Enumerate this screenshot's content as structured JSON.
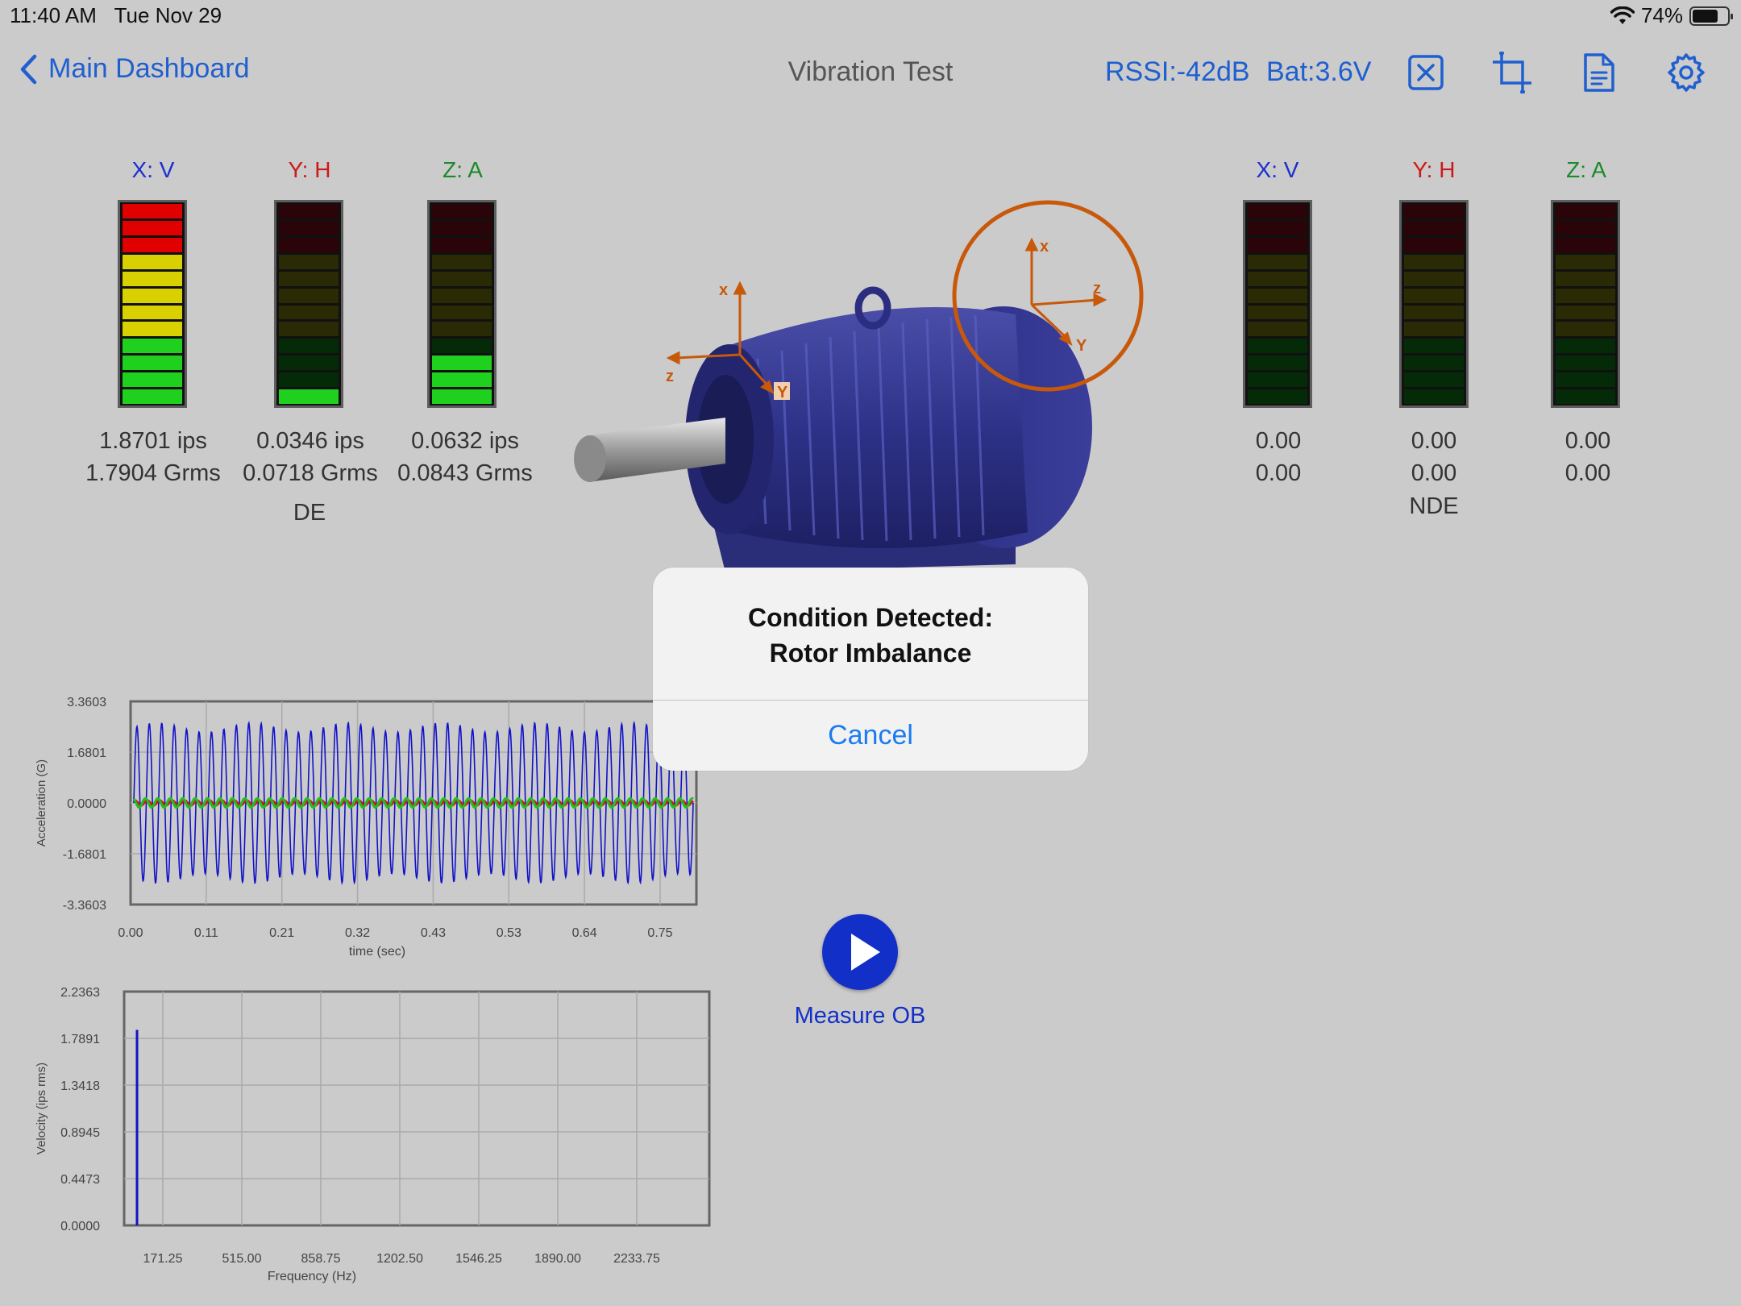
{
  "status": {
    "time": "11:40 AM",
    "date": "Tue Nov 29",
    "battery": "74%",
    "battery_level": 0.74,
    "wifi_icon": "wifi-icon"
  },
  "nav": {
    "back_label": "Main Dashboard",
    "title": "Vibration Test",
    "rssi": "RSSI:-42dB",
    "bat": "Bat:3.6V",
    "icons": [
      "close-box-icon",
      "crop-icon",
      "document-icon",
      "gear-icon"
    ],
    "accent_color": "#1f5fcf"
  },
  "sensors": {
    "de": {
      "label": "DE",
      "channels": [
        {
          "axis": "X: V",
          "color": "#1a2fd0",
          "lit_segments": 12,
          "ips": "1.8701 ips",
          "grms": "1.7904 Grms"
        },
        {
          "axis": "Y: H",
          "color": "#cc1a1a",
          "lit_segments": 1,
          "ips": "0.0346 ips",
          "grms": "0.0718 Grms"
        },
        {
          "axis": "Z: A",
          "color": "#1a8a2a",
          "lit_segments": 3,
          "ips": "0.0632 ips",
          "grms": "0.0843 Grms"
        }
      ]
    },
    "nde": {
      "label": "NDE",
      "channels": [
        {
          "axis": "X: V",
          "color": "#1a2fd0",
          "lit_segments": 0,
          "ips": "0.00",
          "grms": "0.00"
        },
        {
          "axis": "Y: H",
          "color": "#cc1a1a",
          "lit_segments": 0,
          "ips": "0.00",
          "grms": "0.00"
        },
        {
          "axis": "Z: A",
          "color": "#1a8a2a",
          "lit_segments": 0,
          "ips": "0.00",
          "grms": "0.00"
        }
      ]
    },
    "segment_count": 12,
    "segment_colors": {
      "red": "#e00000",
      "yellow": "#d8d000",
      "green": "#1fd01f",
      "red_off": "#2a0408",
      "yellow_off": "#2a2a04",
      "green_off": "#052a08"
    }
  },
  "motor_axes": {
    "de": [
      "x",
      "z",
      "Y"
    ],
    "nde": [
      "x",
      "z",
      "Y"
    ]
  },
  "chart_data": [
    {
      "type": "line",
      "xlabel": "time (sec)",
      "ylabel": "Acceleration (G)",
      "xlim": [
        0,
        0.75
      ],
      "ylim": [
        -3.3603,
        3.3603
      ],
      "x_ticks": [
        "0.00",
        "0.11",
        "0.21",
        "0.32",
        "0.43",
        "0.53",
        "0.64",
        "0.75"
      ],
      "y_ticks": [
        "3.3603",
        "1.6801",
        "0.0000",
        "-1.6801",
        "-3.3603"
      ],
      "grid": true,
      "series": [
        {
          "color": "#1212c8",
          "amplitude": 2.6,
          "cycles": 45
        },
        {
          "color": "#cc1a1a",
          "amplitude": 0.08,
          "cycles": 45
        },
        {
          "color": "#1fc01f",
          "amplitude": 0.15,
          "cycles": 45
        }
      ]
    },
    {
      "type": "bar",
      "xlabel": "Frequency (Hz)",
      "ylabel": "Velocity (ips rms)",
      "ylim": [
        0,
        2.2363
      ],
      "x_ticks": [
        "171.25",
        "515.00",
        "858.75",
        "1202.50",
        "1546.25",
        "1890.00",
        "2233.75"
      ],
      "y_ticks": [
        "2.2363",
        "1.7891",
        "1.3418",
        "0.8945",
        "0.4473",
        "0.0000"
      ],
      "grid": true,
      "peaks": [
        {
          "frequency": 60,
          "value": 1.87,
          "color": "#1212c8"
        }
      ]
    }
  ],
  "measure": {
    "label": "Measure OB",
    "icon": "play-icon",
    "color": "#1230c8"
  },
  "alert": {
    "title_line1": "Condition Detected:",
    "title_line2": "Rotor Imbalance",
    "cancel_label": "Cancel"
  }
}
